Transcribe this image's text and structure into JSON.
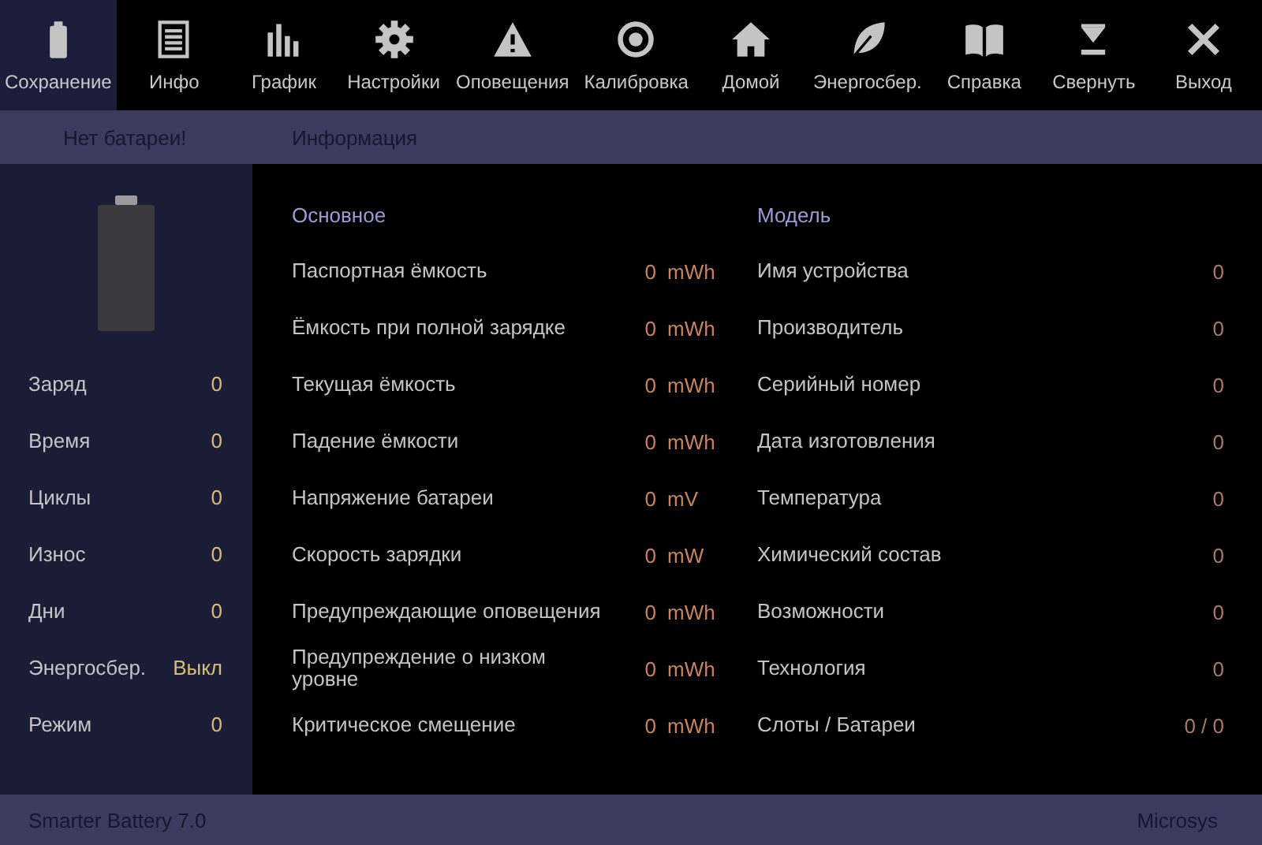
{
  "toolbar": [
    {
      "label": "Сохранение",
      "selected": true
    },
    {
      "label": "Инфо",
      "selected": false
    },
    {
      "label": "График",
      "selected": false
    },
    {
      "label": "Настройки",
      "selected": false
    },
    {
      "label": "Оповещения",
      "selected": false
    },
    {
      "label": "Калибровка",
      "selected": false
    },
    {
      "label": "Домой",
      "selected": false
    },
    {
      "label": "Энергосбер.",
      "selected": false
    },
    {
      "label": "Справка",
      "selected": false
    },
    {
      "label": "Свернуть",
      "selected": false
    },
    {
      "label": "Выход",
      "selected": false
    }
  ],
  "subheader": {
    "status": "Нет батареи!",
    "title": "Информация"
  },
  "sidebar": {
    "rows": [
      {
        "label": "Заряд",
        "value": "0"
      },
      {
        "label": "Время",
        "value": "0"
      },
      {
        "label": "Циклы",
        "value": "0"
      },
      {
        "label": "Износ",
        "value": "0"
      },
      {
        "label": "Дни",
        "value": "0"
      },
      {
        "label": "Энергосбер.",
        "value": "Выкл"
      },
      {
        "label": "Режим",
        "value": "0"
      }
    ]
  },
  "sections": [
    {
      "title": "Основное",
      "rows": [
        {
          "label": "Паспортная ёмкость",
          "value": "0",
          "unit": "mWh"
        },
        {
          "label": "Ёмкость при полной зарядке",
          "value": "0",
          "unit": "mWh"
        },
        {
          "label": "Текущая ёмкость",
          "value": "0",
          "unit": "mWh"
        },
        {
          "label": "Падение ёмкости",
          "value": "0",
          "unit": "mWh"
        },
        {
          "label": "Напряжение батареи",
          "value": "0",
          "unit": "mV"
        },
        {
          "label": "Скорость зарядки",
          "value": "0",
          "unit": "mW"
        },
        {
          "label": "Предупреждающие оповещения",
          "value": "0",
          "unit": "mWh"
        },
        {
          "label": "Предупреждение о низком уровне",
          "value": "0",
          "unit": "mWh"
        },
        {
          "label": "Критическое смещение",
          "value": "0",
          "unit": "mWh"
        }
      ]
    },
    {
      "title": "Модель",
      "rows": [
        {
          "label": "Имя устройства",
          "value": "0"
        },
        {
          "label": "Производитель",
          "value": "0"
        },
        {
          "label": "Серийный номер",
          "value": "0"
        },
        {
          "label": "Дата изготовления",
          "value": "0"
        },
        {
          "label": "Температура",
          "value": "0"
        },
        {
          "label": "Химический состав",
          "value": "0"
        },
        {
          "label": "Возможности",
          "value": "0"
        },
        {
          "label": "Технология",
          "value": "0"
        },
        {
          "label": "Слоты / Батареи",
          "value": "0 / 0"
        }
      ]
    }
  ],
  "status_bar": {
    "app": "Smarter Battery 7.0",
    "vendor": "Microsys"
  }
}
